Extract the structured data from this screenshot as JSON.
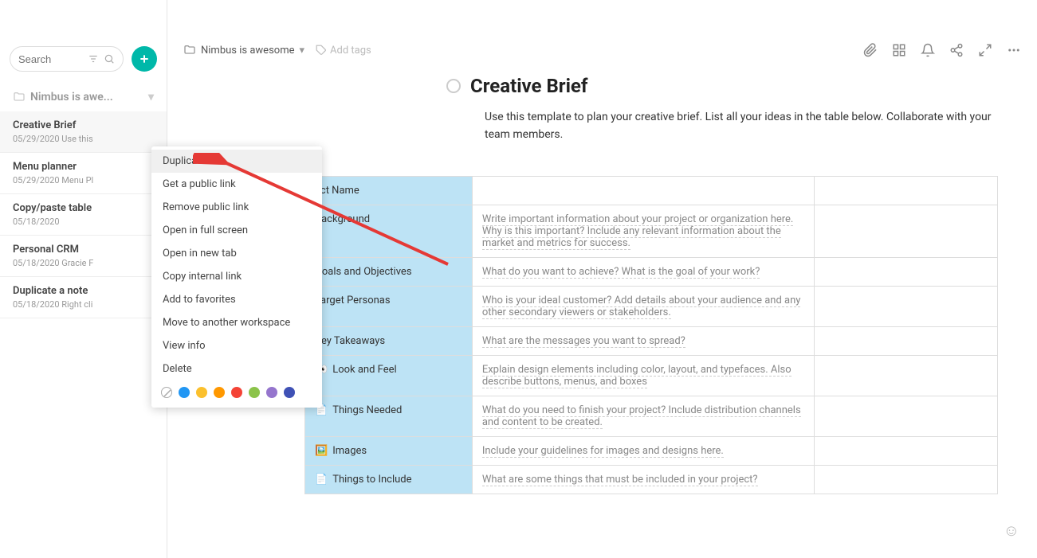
{
  "sidebar": {
    "search_placeholder": "Search",
    "workspace_label": "Nimbus is awe...",
    "notes": [
      {
        "title": "Creative Brief",
        "date": "05/29/2020",
        "preview": "Use this"
      },
      {
        "title": "Menu planner",
        "date": "05/29/2020",
        "preview": "Menu Pl"
      },
      {
        "title": "Copy/paste table",
        "date": "05/18/2020",
        "preview": ""
      },
      {
        "title": "Personal CRM",
        "date": "05/18/2020",
        "preview": "Gracie F"
      },
      {
        "title": "Duplicate a note",
        "date": "05/18/2020",
        "preview": "Right cli"
      }
    ]
  },
  "topbar": {
    "breadcrumb": "Nimbus is awesome",
    "add_tags": "Add tags"
  },
  "main": {
    "title": "Creative Brief",
    "description": "Use this template to plan your creative brief. List all your ideas in the table below. Collaborate with your team members.",
    "rows": [
      {
        "icon": "",
        "label": "ect Name",
        "desc": ""
      },
      {
        "icon": "",
        "label": "Background",
        "desc": "Write important information about your project or organization here. Why is this important? Include any relevant information about the market and metrics for success."
      },
      {
        "icon": "",
        "label": "Goals and Objectives",
        "desc": "What do you want to achieve? What is the goal of your work?"
      },
      {
        "icon": "",
        "label": "Target Personas",
        "desc": "Who is your ideal customer? Add details about your audience and any other secondary viewers or stakeholders."
      },
      {
        "icon": "",
        "label": "Key Takeaways",
        "desc": "What are the messages you want to spread?"
      },
      {
        "icon": "👀",
        "label": "Look and Feel",
        "desc": "Explain design elements including color, layout, and typefaces. Also describe buttons, menus, and boxes"
      },
      {
        "icon": "📄",
        "label": "Things Needed",
        "desc": "What do you need to finish your project? Include distribution channels and content to be created."
      },
      {
        "icon": "🖼️",
        "label": "Images",
        "desc": "Include your guidelines for images and designs here."
      },
      {
        "icon": "📄",
        "label": "Things to Include",
        "desc": "What are some things that must be included in your project?"
      }
    ]
  },
  "context_menu": {
    "items": [
      "Duplicate",
      "Get a public link",
      "Remove public link",
      "Open in full screen",
      "Open in new tab",
      "Copy internal link",
      "Add to favorites",
      "Move to another workspace",
      "View info",
      "Delete"
    ],
    "colors": [
      "#ffffff",
      "#2196f3",
      "#fbc02d",
      "#ff9800",
      "#f44336",
      "#8bc34a",
      "#9575cd",
      "#3f51b5"
    ]
  }
}
